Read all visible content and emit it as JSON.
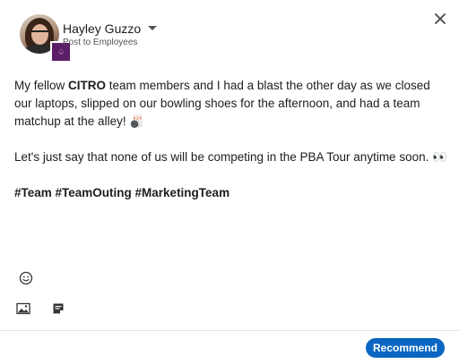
{
  "author": {
    "name": "Hayley Guzzo",
    "audience": "Post to Employees"
  },
  "company_badge_glyph": "♤",
  "post": {
    "line1_pre": "My fellow ",
    "line1_bold": "CITRO",
    "line1_post": " team members and I had a blast the other day as we closed our laptops, slipped on our bowling shoes for the afternoon, and had a team matchup at the alley! 🎳",
    "line2": "Let's just say that none of us will be competing in the PBA Tour anytime soon. 👀",
    "hashtags": "#Team #TeamOuting #MarketingTeam"
  },
  "toolbar": {
    "emoji_icon": "smile-icon",
    "image_icon": "image-icon",
    "document_icon": "document-icon"
  },
  "footer": {
    "recommend_label": "Recommend"
  },
  "colors": {
    "primary": "#0a66c2",
    "badge": "#5b1e66"
  }
}
